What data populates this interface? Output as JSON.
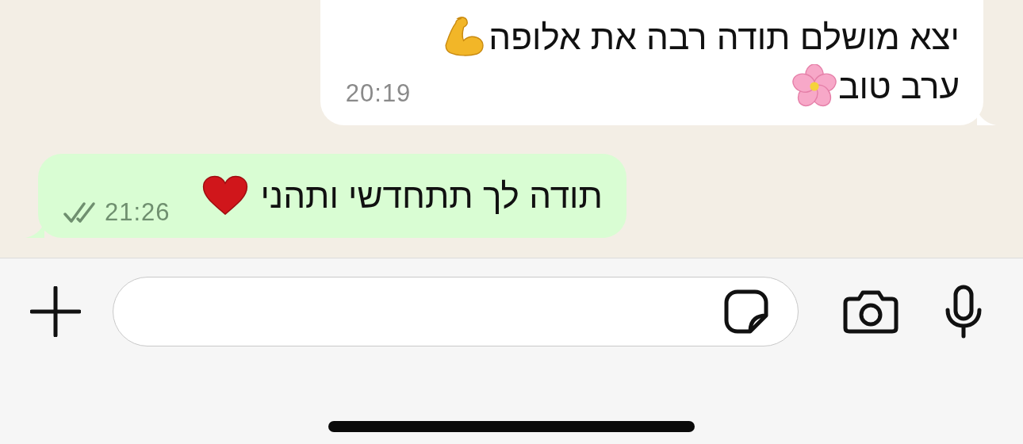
{
  "messages": [
    {
      "kind": "incoming",
      "lines": [
        {
          "text": "יצא מושלם תודה רבה את אלופה",
          "kind": "flexed-arm"
        },
        {
          "text": "ערב טוב",
          "kind": "blossom"
        }
      ],
      "time": "20:19"
    },
    {
      "kind": "outgoing",
      "lines": [
        {
          "text": "תודה לך תתחדשי ותהני",
          "kind": "heart"
        }
      ],
      "time": "21:26",
      "read": false
    }
  ]
}
